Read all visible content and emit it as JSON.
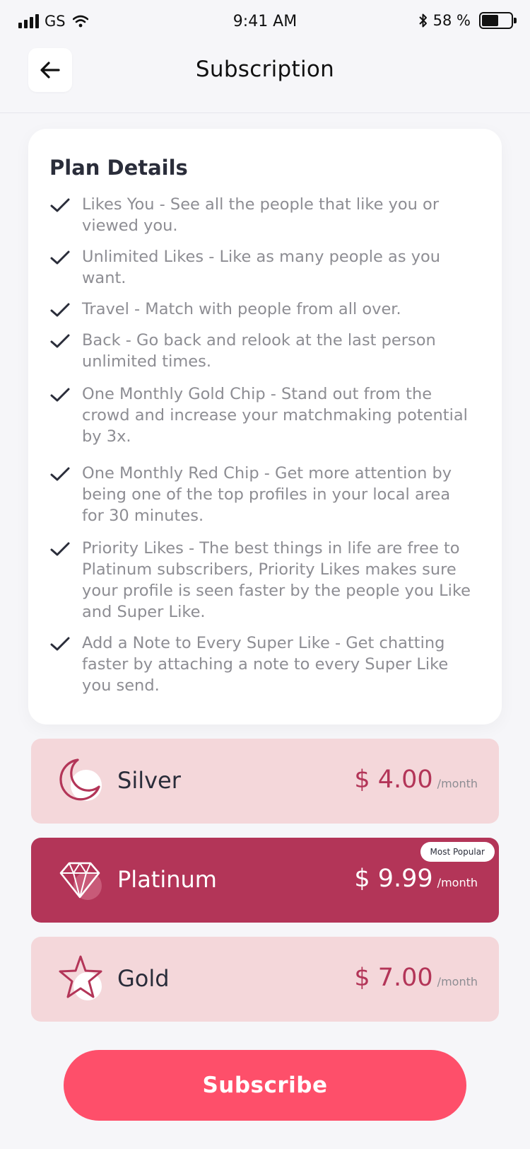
{
  "status_bar": {
    "carrier": "GS",
    "time": "9:41 AM",
    "battery_label": "58 %",
    "battery_level": 0.58
  },
  "header": {
    "title": "Subscription"
  },
  "plan_details": {
    "title": "Plan Details",
    "features": [
      "Likes You - See all the people that like you or viewed you.",
      "Unlimited Likes - Like as many people as you want.",
      "Travel - Match with people from all over.",
      "Back - Go back and relook at the last person unlimited times.",
      "One Monthly Gold Chip - Stand out from the crowd and increase your matchmaking potential by 3x.",
      "One Monthly Red Chip - Get more attention by being one of the top profiles in your local area for 30 minutes.",
      "Priority Likes - The best things in life are free to Platinum subscribers, Priority Likes makes sure your profile is seen faster by the people you Like and Super Like.",
      "Add a Note to Every Super Like - Get chatting faster by attaching a note to every Super Like you send."
    ]
  },
  "tiers": [
    {
      "name": "Silver",
      "price": "$ 4.00",
      "period": "/month",
      "icon": "moon-icon"
    },
    {
      "name": "Platinum",
      "price": "$ 9.99",
      "period": "/month",
      "icon": "diamond-icon",
      "badge": "Most Popular",
      "selected": true
    },
    {
      "name": "Gold",
      "price": "$ 7.00",
      "period": "/month",
      "icon": "star-icon"
    }
  ],
  "subscribe_label": "Subscribe",
  "colors": {
    "accent": "#b33558",
    "tier_bg": "#f4d7da",
    "button": "#fe4f6a"
  }
}
